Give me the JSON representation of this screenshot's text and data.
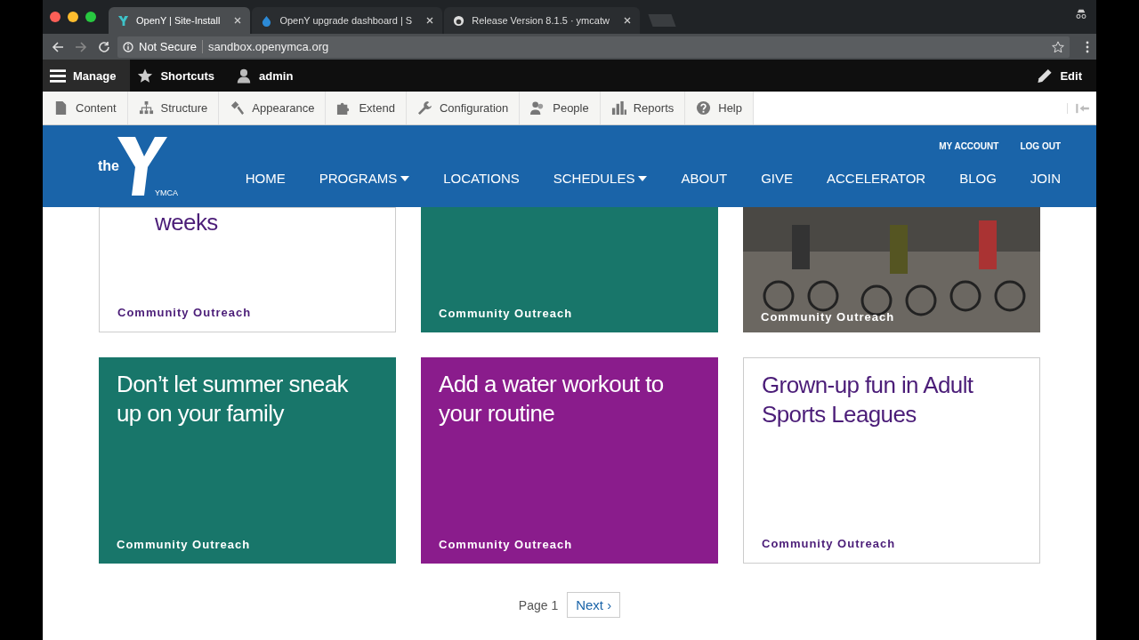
{
  "browser": {
    "tabs": [
      {
        "title": "OpenY | Site-Install",
        "selected": true
      },
      {
        "title": "OpenY upgrade dashboard | S",
        "selected": false
      },
      {
        "title": "Release Version 8.1.5 · ymcatw",
        "selected": false
      }
    ],
    "security": "Not Secure",
    "url": "sandbox.openymca.org"
  },
  "admin_bar": {
    "items": [
      {
        "label": "Manage",
        "selected": true
      },
      {
        "label": "Shortcuts",
        "selected": false
      },
      {
        "label": "admin",
        "selected": false
      }
    ],
    "edit": "Edit"
  },
  "admin_menu": [
    {
      "label": "Content"
    },
    {
      "label": "Structure"
    },
    {
      "label": "Appearance"
    },
    {
      "label": "Extend"
    },
    {
      "label": "Configuration"
    },
    {
      "label": "People"
    },
    {
      "label": "Reports"
    },
    {
      "label": "Help"
    }
  ],
  "site_header": {
    "logo_text": "the",
    "logo_tag": "YMCA",
    "utility_links": [
      "MY ACCOUNT",
      "LOG OUT"
    ],
    "nav": [
      {
        "label": "HOME",
        "dropdown": false
      },
      {
        "label": "PROGRAMS",
        "dropdown": true
      },
      {
        "label": "LOCATIONS",
        "dropdown": false
      },
      {
        "label": "SCHEDULES",
        "dropdown": true
      },
      {
        "label": "ABOUT",
        "dropdown": false
      },
      {
        "label": "GIVE",
        "dropdown": false
      },
      {
        "label": "ACCELERATOR",
        "dropdown": false
      },
      {
        "label": "BLOG",
        "dropdown": false
      },
      {
        "label": "JOIN",
        "dropdown": false
      }
    ]
  },
  "cards": [
    {
      "kind": "plain",
      "title": "weeks",
      "category": "Community Outreach"
    },
    {
      "kind": "solid",
      "color": "#18766a",
      "category": "Community Outreach"
    },
    {
      "kind": "photo",
      "category": "Community Outreach"
    },
    {
      "kind": "solid",
      "color": "#18766a",
      "title": "Don’t let summer sneak up on your family",
      "category": "Community Outreach"
    },
    {
      "kind": "solid",
      "color": "#8a1c8c",
      "title": "Add a water workout to your routine",
      "category": "Community Outreach"
    },
    {
      "kind": "plain",
      "title": "Grown-up fun in Adult Sports Leagues",
      "category": "Community Outreach"
    }
  ],
  "pager": {
    "current": "Page 1",
    "next": "Next ›"
  }
}
